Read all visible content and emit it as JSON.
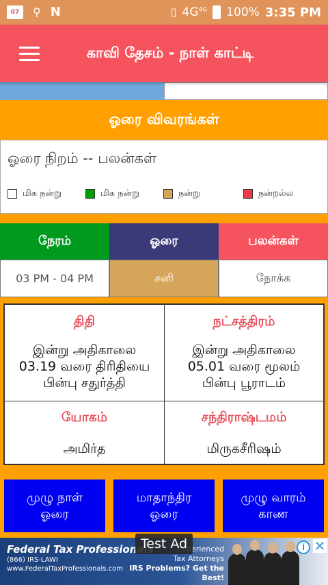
{
  "status_bar": {
    "calendar_day": "07",
    "network": "4G",
    "network_small": "4G",
    "battery": "100%",
    "time": "3:35 PM"
  },
  "app_bar": {
    "title": "காவி தேசம் - நாள் காட்டி"
  },
  "orai": {
    "section_title": "ஓரை விவரங்கள்",
    "legend_heading": "ஓரை நிறம் -- பலன்கள்",
    "legend": [
      {
        "label": "மிக நன்று",
        "color": "#ffffff"
      },
      {
        "label": "மிக நன்று",
        "color": "#00a000"
      },
      {
        "label": "நன்று",
        "color": "#d4a55a"
      },
      {
        "label": "நன்றல்ல",
        "color": "#f03a4a"
      }
    ],
    "headers": {
      "time": "நேரம்",
      "orai": "ஓரை",
      "palan": "பலன்கள்"
    },
    "values": {
      "time": "03 PM - 04 PM",
      "orai": "சனி",
      "palan": "நோக்க"
    },
    "header_colors": {
      "time": "#009a1f",
      "orai": "#3a3a78",
      "palan": "#f5545f"
    },
    "value_colors": {
      "orai_bg": "#d4a55a"
    }
  },
  "panchang": {
    "thithi": {
      "title": "திதி",
      "lines": [
        "இன்று அதிகாலை",
        "03.19 வரை திரிதியை",
        "பின்பு சதுர்த்தி"
      ]
    },
    "nakshatra": {
      "title": "நட்சத்திரம்",
      "lines": [
        "இன்று அதிகாலை",
        "05.01 வரை மூலம்",
        "பின்பு பூராடம்"
      ]
    },
    "yogam": {
      "title": "யோகம்",
      "value": "அமிர்த"
    },
    "chandrashtamam": {
      "title": "சந்திராஷ்டமம்",
      "value": "மிருகசீரிஷம்"
    }
  },
  "buttons": [
    {
      "label": "முழு நாள்\nஓரை"
    },
    {
      "label": "மாதாந்திர\nஓரை"
    },
    {
      "label": "முழு வாரம்\nகாண"
    }
  ],
  "ad": {
    "brand": "Federal Tax Professionals",
    "phone": "(866) IRS-LAWI",
    "url": "www.FederalTaxProfessionals.com",
    "tagline_1": "Experienced",
    "tagline_2": "Tax Attorneys",
    "tagline_3": "IRS Problems? Get the Best!",
    "badge": "Test Ad"
  }
}
